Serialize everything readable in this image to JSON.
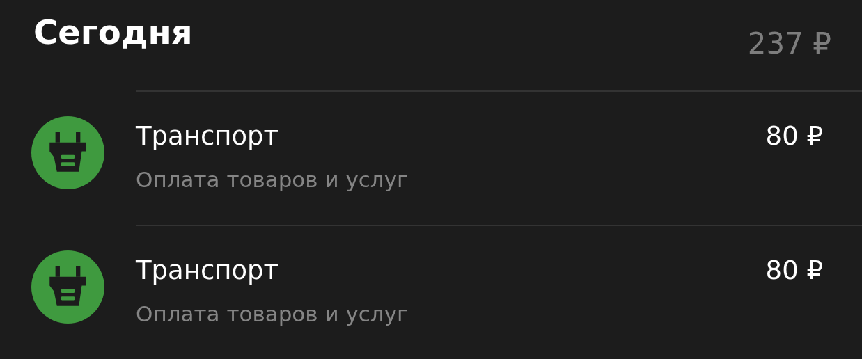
{
  "header": {
    "title": "Сегодня",
    "total": "237 ₽"
  },
  "transactions": [
    {
      "title": "Транспорт",
      "subtitle": "Оплата товаров и услуг",
      "amount": "80 ₽"
    },
    {
      "title": "Транспорт",
      "subtitle": "Оплата товаров и услуг",
      "amount": "80 ₽"
    }
  ]
}
